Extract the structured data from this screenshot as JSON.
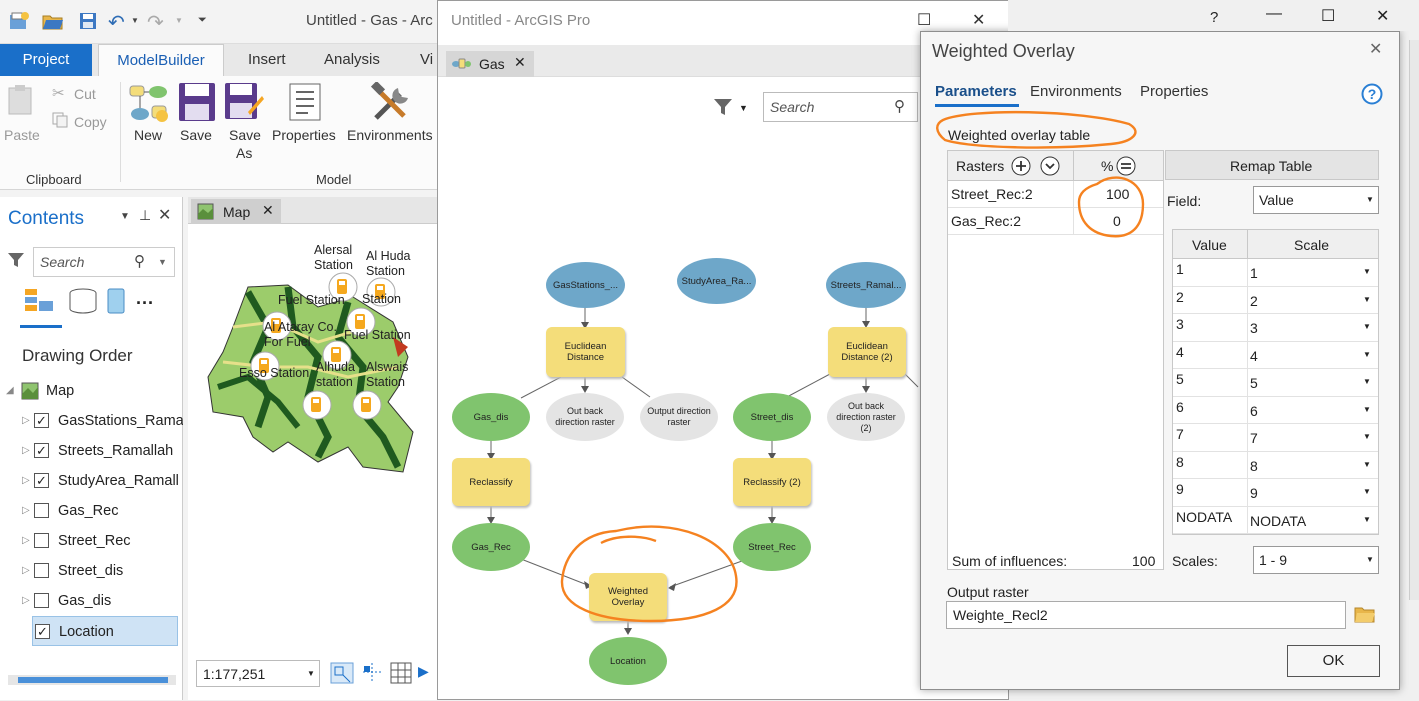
{
  "app": {
    "title": "Untitled - Gas - ArcGIS Pro",
    "title_visible": "Untitled - Gas - Arc",
    "tabs": [
      "Project",
      "ModelBuilder",
      "Insert",
      "Analysis",
      "Vi"
    ],
    "ribbon": {
      "clipboard": {
        "paste": "Paste",
        "cut": "Cut",
        "copy": "Copy",
        "group": "Clipboard"
      },
      "model": {
        "new": "New",
        "save": "Save",
        "save_as_1": "Save",
        "save_as_2": "As",
        "properties": "Properties",
        "environments": "Environments",
        "group": "Model"
      }
    }
  },
  "contents": {
    "title": "Contents",
    "search_placeholder": "Search",
    "drawing_order": "Drawing Order",
    "map_label": "Map",
    "layers": [
      {
        "name": "GasStations_Rama",
        "checked": true
      },
      {
        "name": "Streets_Ramallah",
        "checked": true
      },
      {
        "name": "StudyArea_Ramall",
        "checked": true
      },
      {
        "name": "Gas_Rec",
        "checked": false
      },
      {
        "name": "Street_Rec",
        "checked": false
      },
      {
        "name": "Street_dis",
        "checked": false
      },
      {
        "name": "Gas_dis",
        "checked": false
      },
      {
        "name": "Location",
        "checked": true
      }
    ]
  },
  "map": {
    "tab": "Map",
    "scale": "1:177,251",
    "labels": [
      "Alersal Station",
      "Al Huda Station",
      "Fuel Station",
      "Al Ataray Co. For Fuel",
      "Fuel Station",
      "Esso Station",
      "Alhuda station",
      "Alswais Station",
      "Station"
    ]
  },
  "model_window": {
    "title": "Untitled - ArcGIS Pro",
    "tab": "Gas",
    "search_placeholder": "Search",
    "nodes": {
      "gasstations": "GasStations_...",
      "studyarea": "StudyArea_Ra...",
      "streets": "Streets_Ramal...",
      "euclid1": "Euclidean Distance",
      "euclid2": "Euclidean Distance (2)",
      "gas_dis": "Gas_dis",
      "outback1": "Out back direction raster",
      "outdir1": "Output direction raster",
      "street_dis": "Street_dis",
      "outback2": "Out back direction raster (2)",
      "reclass1": "Reclassify",
      "reclass2": "Reclassify (2)",
      "gas_rec": "Gas_Rec",
      "street_rec": "Street_Rec",
      "weighted": "Weighted Overlay",
      "location": "Location"
    }
  },
  "dialog": {
    "title": "Weighted Overlay",
    "tabs": [
      "Parameters",
      "Environments",
      "Properties"
    ],
    "table_label": "Weighted overlay table",
    "rasters_header": "Rasters",
    "percent_header": "%",
    "rasters": [
      {
        "name": "Street_Rec:2",
        "percent": "100"
      },
      {
        "name": "Gas_Rec:2",
        "percent": "0"
      }
    ],
    "remap_header": "Remap Table",
    "field_label": "Field:",
    "field_value": "Value",
    "value_header": "Value",
    "scale_header": "Scale",
    "remap_rows": [
      {
        "value": "1",
        "scale": "1"
      },
      {
        "value": "2",
        "scale": "2"
      },
      {
        "value": "3",
        "scale": "3"
      },
      {
        "value": "4",
        "scale": "4"
      },
      {
        "value": "5",
        "scale": "5"
      },
      {
        "value": "6",
        "scale": "6"
      },
      {
        "value": "7",
        "scale": "7"
      },
      {
        "value": "8",
        "scale": "8"
      },
      {
        "value": "9",
        "scale": "9"
      },
      {
        "value": "NODATA",
        "scale": "NODATA"
      }
    ],
    "sum_label": "Sum of influences:",
    "sum_value": "100",
    "scales_label": "Scales:",
    "scales_value": "1 - 9",
    "output_label": "Output raster",
    "output_value": "Weighte_Recl2",
    "ok": "OK"
  },
  "colors": {
    "project_tab": "#1a6fc9",
    "node_blue": "#6ea7c9",
    "node_green": "#80c46e",
    "node_yellow": "#f4dd7a",
    "annotation": "#f58220"
  }
}
